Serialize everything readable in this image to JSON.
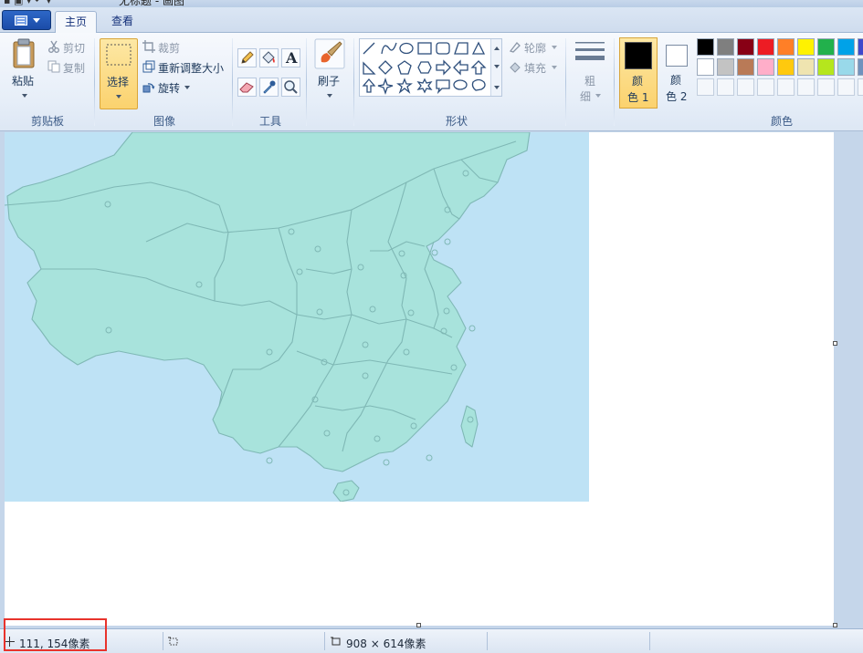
{
  "window": {
    "title": "无标题 - 画图"
  },
  "tabs": [
    {
      "label": "主页",
      "active": true
    },
    {
      "label": "查看",
      "active": false
    }
  ],
  "clipboard": {
    "paste_label": "粘贴",
    "cut_label": "剪切",
    "copy_label": "复制",
    "group_label": "剪贴板"
  },
  "image": {
    "select_label": "选择",
    "crop_label": "裁剪",
    "resize_label": "重新调整大小",
    "rotate_label": "旋转",
    "group_label": "图像"
  },
  "tools": {
    "group_label": "工具",
    "text_tool_glyph": "A"
  },
  "brushes": {
    "label": "刷子"
  },
  "shapes": {
    "outline_label": "轮廓",
    "fill_label": "填充",
    "group_label": "形状"
  },
  "size": {
    "label_line1": "粗",
    "label_line2": "细"
  },
  "colors": {
    "color1_line1": "颜",
    "color1_line2": "色 1",
    "color2_line1": "颜",
    "color2_line2": "色 2",
    "group_label": "颜色",
    "color1_value": "#000000",
    "color2_value": "#ffffff",
    "palette_row1": [
      "#000000",
      "#7f7f7f",
      "#880015",
      "#ed1c24",
      "#ff7f27",
      "#fff200",
      "#22b14c",
      "#00a2e8",
      "#3f48cc"
    ],
    "palette_row2": [
      "#ffffff",
      "#c3c3c3",
      "#b97a57",
      "#ffaec9",
      "#ffc90e",
      "#efe4b0",
      "#b5e61d",
      "#99d9ea",
      "#7092be"
    ]
  },
  "canvas": {
    "content": "china-map-image",
    "map_fill": "#a8e3dc",
    "sea_fill": "#bee2f5"
  },
  "status": {
    "cursor_position": "111, 154像素",
    "selection_size": "",
    "image_size": "908 × 614像素"
  }
}
